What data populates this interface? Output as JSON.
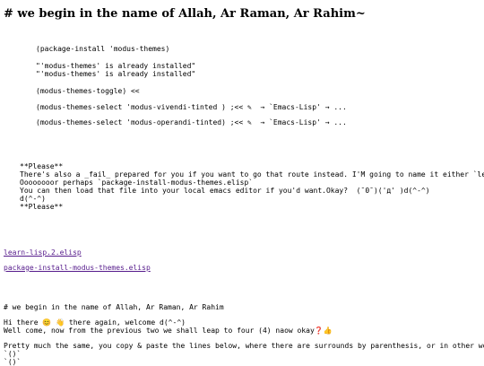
{
  "heading": "# we begin in the name of Allah, Ar Raman, Ar Rahim~",
  "code_block": {
    "line1": "(package-install 'modus-themes)",
    "line2": "\"'modus-themes' is already installed\"",
    "line3": "\"'modus-themes' is already installed\"",
    "line4": "(modus-themes-toggle) <<",
    "line5": "(modus-themes-select 'modus-vivendi-tinted ) ;<< ✎  → `Emacs-Lisp' → ...",
    "line6": "(modus-themes-select 'modus-operandi-tinted) ;<< ✎  → `Emacs-Lisp' → ..."
  },
  "note_block": {
    "line1": "**Please**",
    "line2": "There's also a _fail_ prepared for you if you want to go that route instead. I'M going to name it either `lea",
    "line3": "Oooooooor perhaps `package-install-modus-themes.elisp`",
    "line4": "You can then load that file into your local emacs editor if you'd want.Okay?  (¯0¯)('д' )d(^-^)",
    "line5": "d(^-^)",
    "line6": "**Please**"
  },
  "links": {
    "link1": "learn-lisp.2.elisp",
    "link2": "package-install-modus-themes.elisp"
  },
  "bottom_block": {
    "line1": "# we begin in the name of Allah, Ar Raman, Ar Rahim",
    "line2": "Hi there 😊 👋 there again, welcome d(^-^)",
    "line3": "Well come, now from the previous two we shall leap to four (4) naow okay❓👍",
    "line4": "Pretty much the same, you copy & paste the lines below, where there are surrounds by parenthesis, or in other wor",
    "line5": "`()`",
    "line6": "`()`"
  }
}
